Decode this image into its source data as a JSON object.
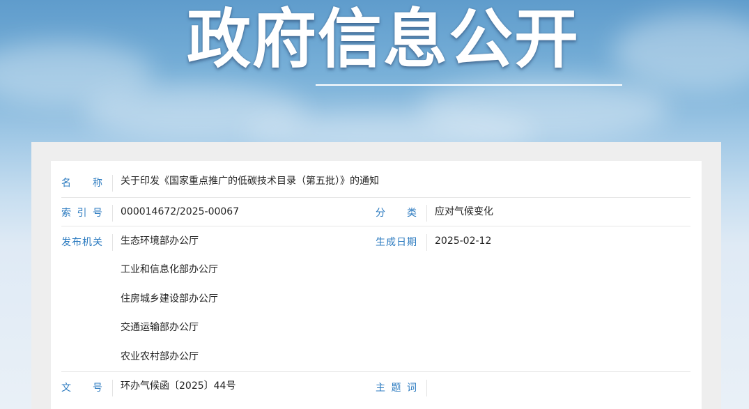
{
  "banner": {
    "title": "政府信息公开"
  },
  "info": {
    "name_label": "名　称",
    "name_value": "关于印发《国家重点推广的低碳技术目录（第五批）》的通知",
    "index_label": "索 引 号",
    "index_value": "000014672/2025-00067",
    "category_label": "分　类",
    "category_value": "应对气候变化",
    "publisher_label": "发布机关",
    "publishers": [
      "生态环境部办公厅",
      "工业和信息化部办公厅",
      "住房城乡建设部办公厅",
      "交通运输部办公厅",
      "农业农村部办公厅"
    ],
    "date_label": "生成日期",
    "date_value": "2025-02-12",
    "doc_no_label": "文　号",
    "doc_no_value": "环办气候函〔2025〕44号",
    "subject_label": "主 题 词",
    "subject_value": ""
  },
  "colors": {
    "label": "#2c7bc0",
    "value": "#222222",
    "divider": "#e6e6e6"
  }
}
